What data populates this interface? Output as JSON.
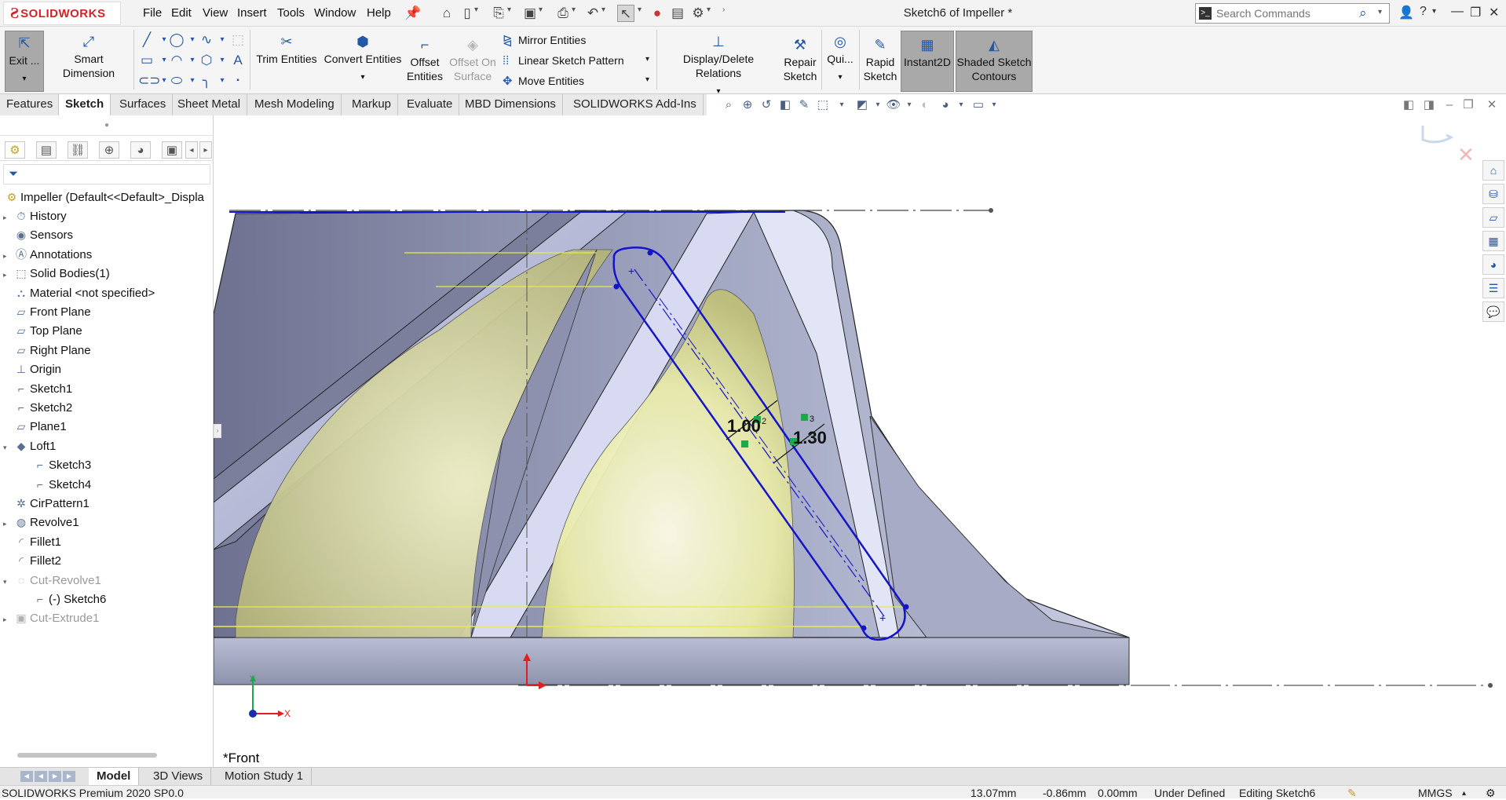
{
  "app": {
    "brand": "SOLIDWORKS",
    "title": "Sketch6 of Impeller *",
    "menu": [
      "File",
      "Edit",
      "View",
      "Insert",
      "Tools",
      "Window",
      "Help"
    ],
    "search_placeholder": "Search Commands",
    "help_label": "?"
  },
  "ribbon": {
    "exit_sketch": "Exit ...",
    "smart_dimension": "Smart Dimension",
    "trim_entities": "Trim Entities",
    "convert_entities": "Convert Entities",
    "offset_entities": "Offset Entities",
    "offset_on_surface": "Offset On Surface",
    "mirror_entities": "Mirror Entities",
    "linear_sketch_pattern": "Linear Sketch Pattern",
    "move_entities": "Move Entities",
    "display_delete_relations": "Display/Delete Relations",
    "repair_sketch": "Repair Sketch",
    "quick_snaps": "Qui...",
    "rapid_sketch": "Rapid Sketch",
    "instant2d": "Instant2D",
    "shaded_sketch_contours": "Shaded Sketch Contours"
  },
  "tabs": [
    "Features",
    "Sketch",
    "Surfaces",
    "Sheet Metal",
    "Mesh Modeling",
    "Markup",
    "Evaluate",
    "MBD Dimensions",
    "SOLIDWORKS Add-Ins"
  ],
  "active_tab": "Sketch",
  "feature_tree": {
    "root": "Impeller  (Default<<Default>_Displa",
    "items": [
      {
        "label": "History",
        "icon": "history-icon",
        "expand": true,
        "indent": 0
      },
      {
        "label": "Sensors",
        "icon": "sensors-icon",
        "expand": false,
        "indent": 0
      },
      {
        "label": "Annotations",
        "icon": "annotations-icon",
        "expand": true,
        "indent": 0
      },
      {
        "label": "Solid Bodies(1)",
        "icon": "solid-bodies-icon",
        "expand": true,
        "indent": 0
      },
      {
        "label": "Material <not specified>",
        "icon": "material-icon",
        "expand": false,
        "indent": 0
      },
      {
        "label": "Front Plane",
        "icon": "plane-icon",
        "expand": false,
        "indent": 0
      },
      {
        "label": "Top Plane",
        "icon": "plane-icon",
        "expand": false,
        "indent": 0
      },
      {
        "label": "Right Plane",
        "icon": "plane-icon",
        "expand": false,
        "indent": 0
      },
      {
        "label": "Origin",
        "icon": "origin-icon",
        "expand": false,
        "indent": 0
      },
      {
        "label": "Sketch1",
        "icon": "sketch-icon",
        "expand": false,
        "indent": 0
      },
      {
        "label": "Sketch2",
        "icon": "sketch-icon",
        "expand": false,
        "indent": 0
      },
      {
        "label": "Plane1",
        "icon": "plane-icon",
        "expand": false,
        "indent": 0
      },
      {
        "label": "Loft1",
        "icon": "loft-icon",
        "expand": "open",
        "indent": 0
      },
      {
        "label": "Sketch3",
        "icon": "sketch-icon",
        "expand": false,
        "indent": 1
      },
      {
        "label": "Sketch4",
        "icon": "sketch-icon",
        "expand": false,
        "indent": 1
      },
      {
        "label": "CirPattern1",
        "icon": "circular-pattern-icon",
        "expand": false,
        "indent": 0
      },
      {
        "label": "Revolve1",
        "icon": "revolve-icon",
        "expand": true,
        "indent": 0
      },
      {
        "label": "Fillet1",
        "icon": "fillet-icon",
        "expand": false,
        "indent": 0
      },
      {
        "label": "Fillet2",
        "icon": "fillet-icon",
        "expand": false,
        "indent": 0
      },
      {
        "label": "Cut-Revolve1",
        "icon": "cut-revolve-icon",
        "expand": "open",
        "indent": 0,
        "dim": true
      },
      {
        "label": "(-) Sketch6",
        "icon": "sketch-icon",
        "expand": false,
        "indent": 1
      },
      {
        "label": "Cut-Extrude1",
        "icon": "cut-extrude-icon",
        "expand": true,
        "indent": 0,
        "dim": true
      }
    ]
  },
  "graphics": {
    "view_label": "*Front",
    "dimension_1": "1.00",
    "dimension_2": "1.30",
    "relation_1": "2",
    "relation_2": "3",
    "triad_x": "X",
    "triad_y": "Y"
  },
  "bottom_tabs": [
    "Model",
    "3D Views",
    "Motion Study 1"
  ],
  "active_bottom_tab": "Model",
  "status": {
    "product": "SOLIDWORKS Premium 2020 SP0.0",
    "x": "13.07mm",
    "y": "-0.86mm",
    "z": "0.00mm",
    "state": "Under Defined",
    "editing": "Editing Sketch6",
    "units": "MMGS"
  },
  "colors": {
    "sketch_blue": "#1414c8",
    "highlight_yellow": "#e8ec4a",
    "brand_red": "#d2232a",
    "relation_green": "#1ea84a"
  }
}
